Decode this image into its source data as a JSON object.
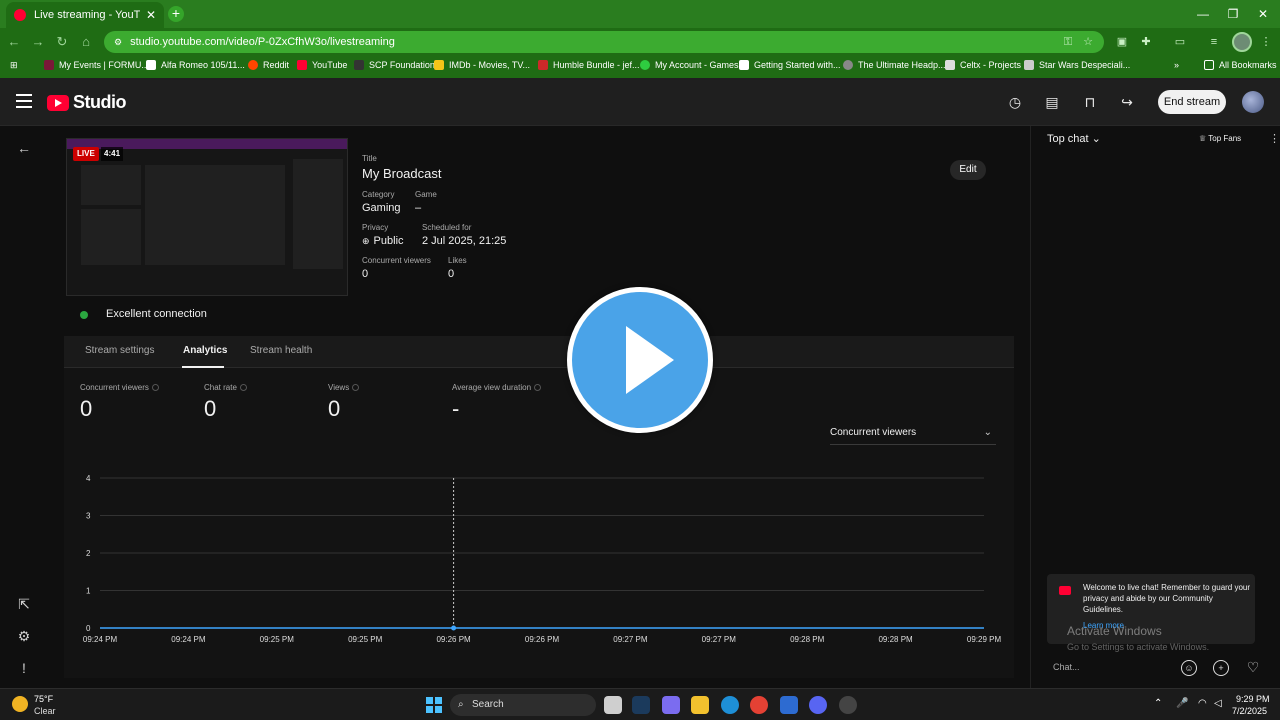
{
  "browser": {
    "tab_title": "Live streaming - YouTube Studi",
    "url": "studio.youtube.com/video/P-0ZxCfhW3o/livestreaming",
    "bookmarks": [
      "My Events | FORMU...",
      "Alfa Romeo 105/11...",
      "Reddit",
      "YouTube",
      "SCP Foundation",
      "IMDb - Movies, TV...",
      "Humble Bundle - jef...",
      "My Account - Games",
      "Getting Started with...",
      "The Ultimate Headp...",
      "Celtx - Projects",
      "Star Wars Despeciali..."
    ],
    "all_bookmarks": "All Bookmarks",
    "accent_color": "#2a7d1f"
  },
  "studio": {
    "logo_text": "Studio",
    "end_stream_label": "End stream",
    "broadcast": {
      "live_badge": "LIVE",
      "live_time": "4:41",
      "title_label": "Title",
      "title": "My Broadcast",
      "category_label": "Category",
      "category": "Gaming",
      "game_label": "Game",
      "game": "–",
      "privacy_label": "Privacy",
      "privacy": "Public",
      "scheduled_label": "Scheduled for",
      "scheduled": "2 Jul 2025, 21:25",
      "concurrent_label": "Concurrent viewers",
      "concurrent": "0",
      "likes_label": "Likes",
      "likes": "0",
      "edit_label": "Edit"
    },
    "connection": "Excellent connection",
    "tabs": [
      "Stream settings",
      "Analytics",
      "Stream health"
    ],
    "active_tab": "Analytics",
    "stats": [
      {
        "label": "Concurrent viewers",
        "value": "0"
      },
      {
        "label": "Chat rate",
        "value": "0"
      },
      {
        "label": "Views",
        "value": "0"
      },
      {
        "label": "Average view duration",
        "value": "-"
      }
    ],
    "metric_select": "Concurrent viewers"
  },
  "chart_data": {
    "type": "line",
    "title": "",
    "xlabel": "",
    "ylabel": "",
    "x_ticks": [
      "09:24 PM",
      "09:24 PM",
      "09:25 PM",
      "09:25 PM",
      "09:26 PM",
      "09:26 PM",
      "09:27 PM",
      "09:27 PM",
      "09:28 PM",
      "09:28 PM",
      "09:29 PM"
    ],
    "y_ticks": [
      0,
      1,
      2,
      3,
      4
    ],
    "ylim": [
      0,
      4
    ],
    "series": [
      {
        "values": [
          0,
          0,
          0,
          0,
          0,
          0,
          0,
          0,
          0,
          0,
          0
        ],
        "color": "#3ea6ff"
      }
    ],
    "cursor_index": 4,
    "grid": true
  },
  "chat": {
    "header": "Top chat",
    "top_fans": "Top Fans",
    "welcome": "Welcome to live chat! Remember to guard your privacy and abide by our Community Guidelines.",
    "learn_more": "Learn more",
    "activate_title": "Activate Windows",
    "activate_sub": "Go to Settings to activate Windows.",
    "input_placeholder": "Chat..."
  },
  "taskbar": {
    "temp": "75°F",
    "condition": "Clear",
    "search": "Search",
    "time": "9:29 PM",
    "date": "7/2/2025"
  }
}
